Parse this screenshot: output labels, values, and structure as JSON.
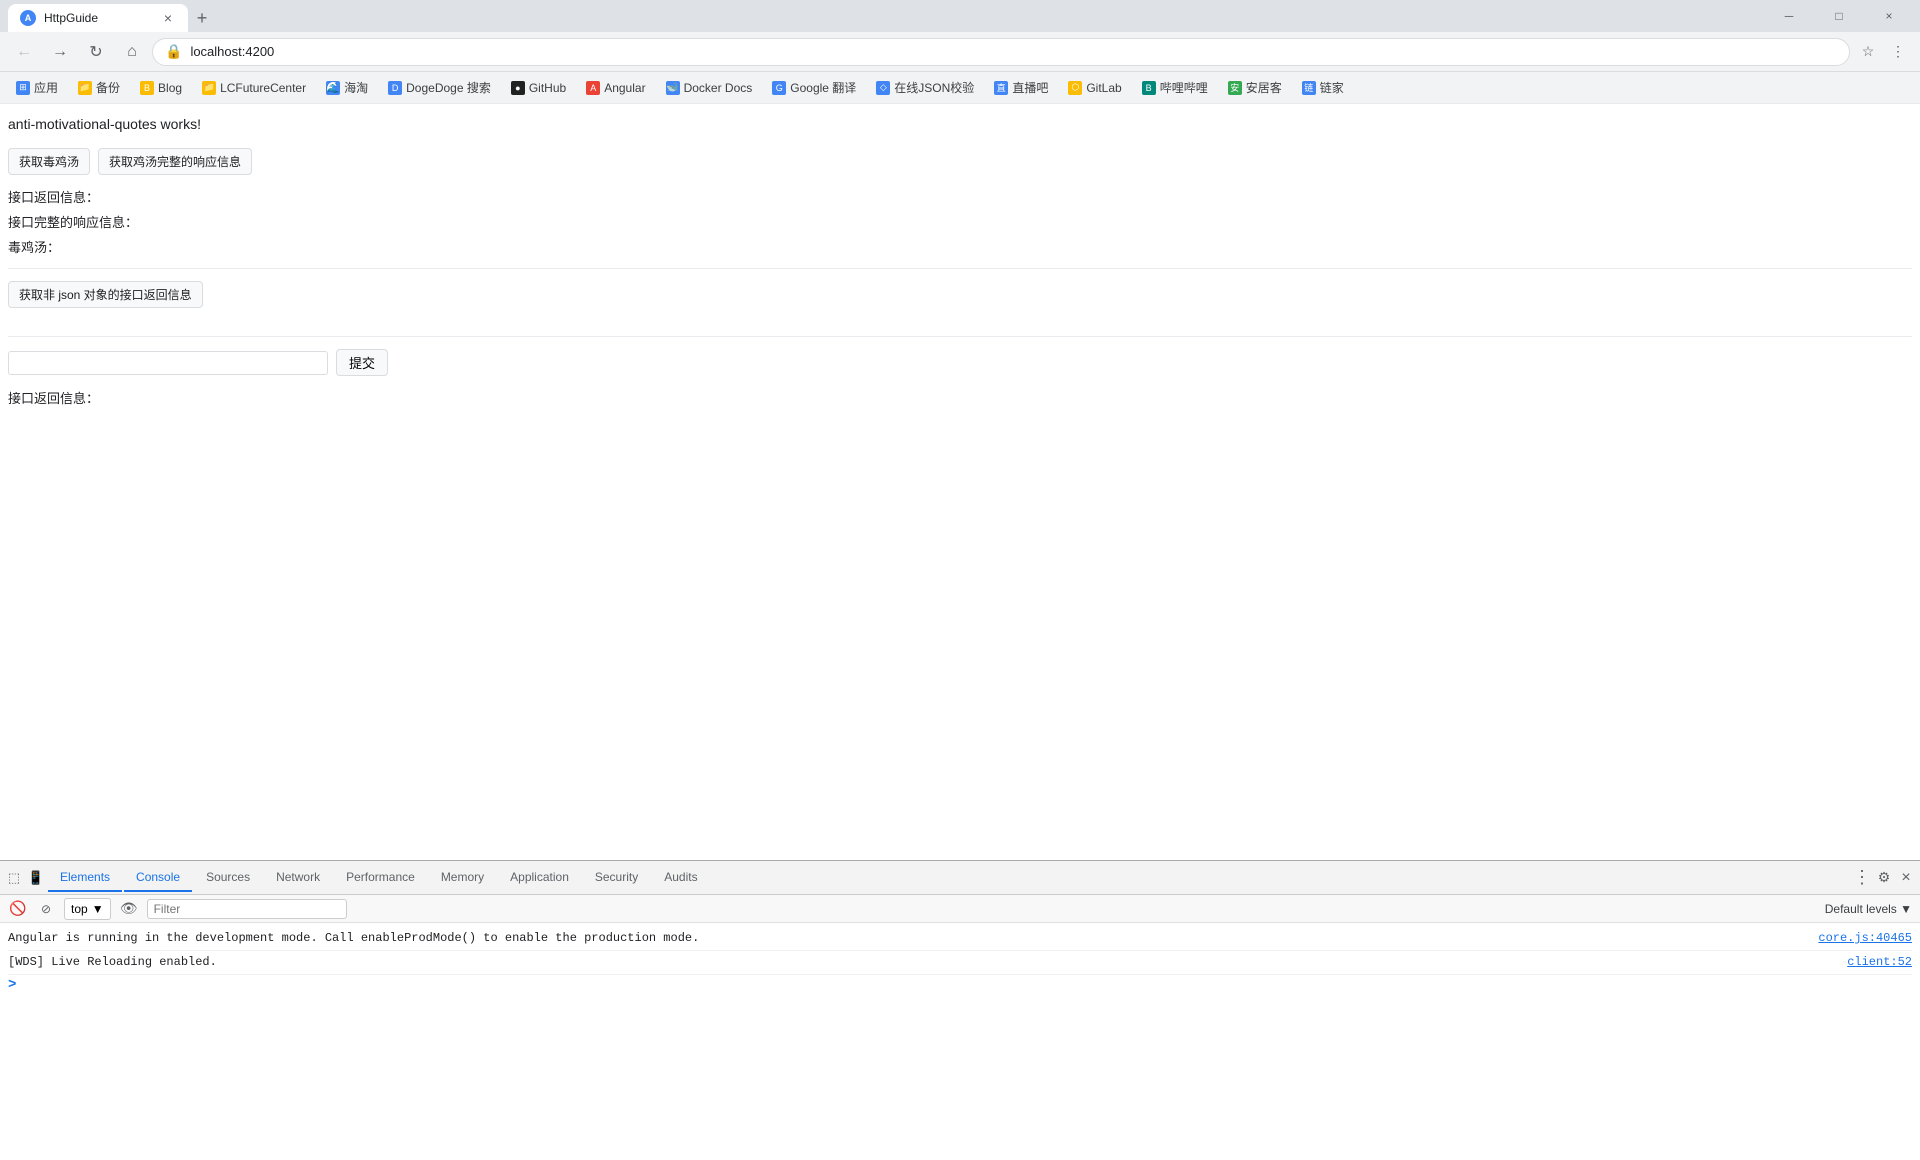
{
  "browser": {
    "tab": {
      "favicon_text": "A",
      "title": "HttpGuide",
      "close": "×",
      "new_tab": "+"
    },
    "window_controls": {
      "minimize": "─",
      "maximize": "□",
      "close": "×"
    },
    "nav": {
      "back": "←",
      "forward": "→",
      "refresh": "↻",
      "home": "⌂",
      "lock_icon": "🔒",
      "url": "localhost:4200",
      "star": "☆",
      "menu": "⋮"
    },
    "bookmarks": [
      {
        "name": "应用",
        "icon": "⊞",
        "color": "fav-blue"
      },
      {
        "name": "备份",
        "icon": "📁",
        "color": "fav-orange"
      },
      {
        "name": "Blog",
        "icon": "B",
        "color": "fav-orange"
      },
      {
        "name": "LCFutureCenter",
        "icon": "📁",
        "color": "fav-orange"
      },
      {
        "name": "海淘",
        "icon": "🌊",
        "color": "fav-blue"
      },
      {
        "name": "DogeDoge 搜索",
        "icon": "D",
        "color": "fav-blue"
      },
      {
        "name": "GitHub",
        "icon": "●",
        "color": "fav-dark"
      },
      {
        "name": "Angular",
        "icon": "A",
        "color": "fav-red"
      },
      {
        "name": "Docker Docs",
        "icon": "🐋",
        "color": "fav-blue"
      },
      {
        "name": "Google 翻译",
        "icon": "G",
        "color": "fav-blue"
      },
      {
        "name": "在线JSON校验",
        "icon": "◇",
        "color": "fav-blue"
      },
      {
        "name": "直播吧",
        "icon": "直",
        "color": "fav-blue"
      },
      {
        "name": "GitLab",
        "icon": "⬡",
        "color": "fav-orange"
      },
      {
        "name": "哔哩哔哩",
        "icon": "B",
        "color": "fav-teal"
      },
      {
        "name": "安居客",
        "icon": "安",
        "color": "fav-green"
      },
      {
        "name": "链家",
        "icon": "链",
        "color": "fav-blue"
      }
    ]
  },
  "page": {
    "title": "anti-motivational-quotes works!",
    "buttons": {
      "get_chicken_soup": "获取毒鸡汤",
      "get_full_response": "获取鸡汤完整的响应信息"
    },
    "labels": {
      "return_info": "接口返回信息：",
      "full_response_info": "接口完整的响应信息：",
      "chicken_soup": "毒鸡汤：",
      "get_non_json": "获取非 json 对象的接口返回信息",
      "return_info2": "接口返回信息："
    },
    "submit_btn": "提交"
  },
  "devtools": {
    "tabs": [
      {
        "label": "Elements",
        "active": false
      },
      {
        "label": "Console",
        "active": true
      },
      {
        "label": "Sources",
        "active": false
      },
      {
        "label": "Network",
        "active": false
      },
      {
        "label": "Performance",
        "active": false
      },
      {
        "label": "Memory",
        "active": false
      },
      {
        "label": "Application",
        "active": false
      },
      {
        "label": "Security",
        "active": false
      },
      {
        "label": "Audits",
        "active": false
      }
    ],
    "toolbar": {
      "context_select": "top",
      "filter_placeholder": "Filter",
      "log_levels": "Default levels ▼"
    },
    "console_messages": [
      {
        "text": "Angular is running in the development mode. Call enableProdMode() to enable the production mode.",
        "source": "core.js:40465"
      },
      {
        "text": "[WDS] Live Reloading enabled.",
        "source": "client:52"
      }
    ],
    "prompt_symbol": ">"
  }
}
